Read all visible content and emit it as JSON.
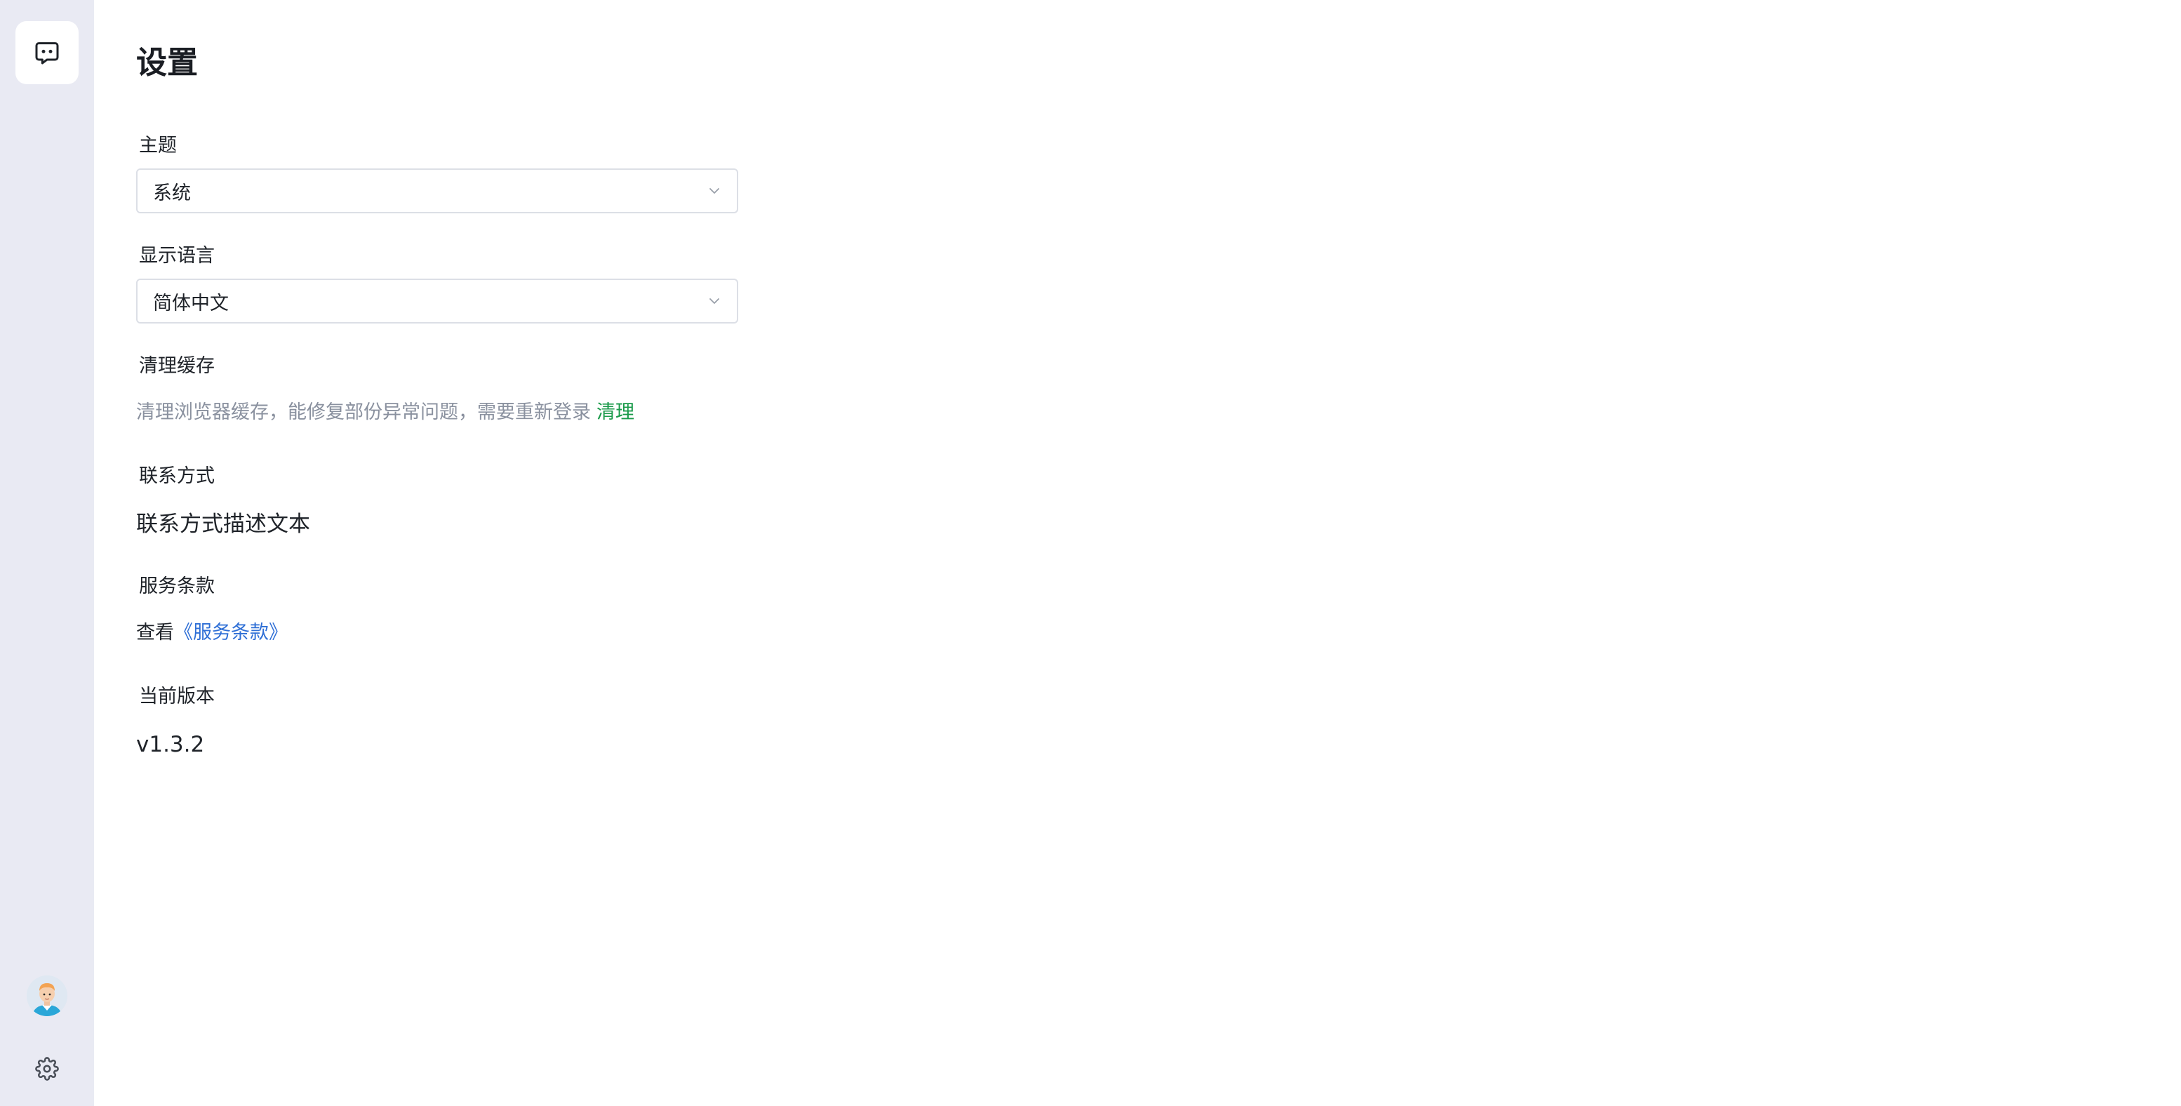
{
  "sidebar": {
    "logo_icon": "chat-bubble-icon",
    "avatar_icon": "user-avatar",
    "settings_icon": "gear-icon"
  },
  "page": {
    "title": "设置"
  },
  "theme": {
    "label": "主题",
    "value": "系统",
    "icon": "chevron-down-icon"
  },
  "language": {
    "label": "显示语言",
    "value": "简体中文",
    "icon": "chevron-down-icon"
  },
  "cache": {
    "label": "清理缓存",
    "description": "清理浏览器缓存，能修复部份异常问题，需要重新登录",
    "action": "清理"
  },
  "contact": {
    "label": "联系方式",
    "text": "联系方式描述文本"
  },
  "terms": {
    "label": "服务条款",
    "prefix": "查看",
    "link": "《服务条款》"
  },
  "version": {
    "label": "当前版本",
    "value": "v1.3.2"
  },
  "colors": {
    "sidebar_bg": "#e9eaf3",
    "clear_link": "#1a9a4a",
    "terms_link": "#2f6fd6",
    "muted_text": "#8a919f"
  }
}
